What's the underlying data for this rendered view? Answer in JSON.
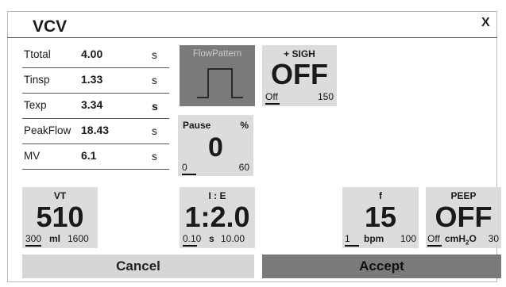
{
  "header": {
    "title": "VCV",
    "close_label": "X"
  },
  "params": [
    {
      "name": "Ttotal",
      "value": "4.00",
      "unit": "s"
    },
    {
      "name": "Tinsp",
      "value": "1.33",
      "unit": "s"
    },
    {
      "name": "Texp",
      "value": "3.34",
      "unit": "s"
    },
    {
      "name": "PeakFlow",
      "value": "18.43",
      "unit": "s"
    },
    {
      "name": "MV",
      "value": "6.1",
      "unit": "s"
    }
  ],
  "flow_pattern": {
    "label": "FlowPattern"
  },
  "sigh": {
    "label": "+ SIGH",
    "value": "OFF",
    "min": "Off",
    "max": "150"
  },
  "pause": {
    "label": "Pause",
    "unit": "%",
    "value": "0",
    "min": "0",
    "max": "60"
  },
  "vt": {
    "label": "VT",
    "value": "510",
    "min": "300",
    "unit": "ml",
    "max": "1600"
  },
  "ie": {
    "label": "I : E",
    "value": "1:2.0",
    "min": "0.10",
    "unit": "s",
    "max": "10.00"
  },
  "f": {
    "label": "f",
    "value": "15",
    "min": "1",
    "unit": "bpm",
    "max": "100"
  },
  "peep": {
    "label": "PEEP",
    "value": "OFF",
    "min": "Off",
    "unit_main": "cmH",
    "unit_sub": "2",
    "unit_end": "O",
    "max": "30"
  },
  "buttons": {
    "cancel": "Cancel",
    "accept": "Accept"
  }
}
